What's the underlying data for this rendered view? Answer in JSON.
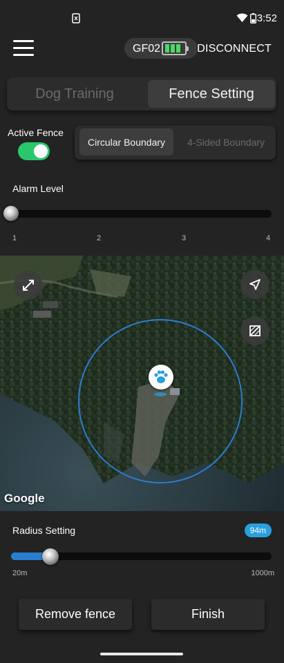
{
  "status_bar": {
    "time": "3:52",
    "icons": [
      "notification-icon",
      "wifi-icon",
      "battery-icon"
    ]
  },
  "header": {
    "menu_icon": "hamburger-icon",
    "device_name": "GF02",
    "device_battery_level": 1.0,
    "disconnect_label": "DISCONNECT"
  },
  "mode_tabs": [
    {
      "label": "Dog Training",
      "selected": false
    },
    {
      "label": "Fence Setting",
      "selected": true
    }
  ],
  "active_fence": {
    "label": "Active Fence",
    "on": true
  },
  "boundary_options": [
    {
      "label": "Circular Boundary",
      "selected": true
    },
    {
      "label": "4-Sided Boundary",
      "selected": false
    }
  ],
  "alarm_level": {
    "label": "Alarm Level",
    "value": 1,
    "min": 1,
    "max": 4,
    "ticks": [
      "1",
      "2",
      "3",
      "4"
    ]
  },
  "map": {
    "attribution": "Google",
    "buttons": [
      "expand-icon",
      "navigation-icon",
      "clear-fence-icon"
    ],
    "marker_icon": "paw-icon"
  },
  "radius": {
    "label": "Radius Setting",
    "value_label": "94m",
    "value": 94,
    "min_label": "20m",
    "max_label": "1000m",
    "min": 20,
    "max": 1000
  },
  "actions": {
    "remove_label": "Remove fence",
    "finish_label": "Finish"
  },
  "colors": {
    "background": "#232323",
    "toggle_on": "#2bc76c",
    "accent_blue": "#2a9fde",
    "battery_green": "#4cd964"
  }
}
